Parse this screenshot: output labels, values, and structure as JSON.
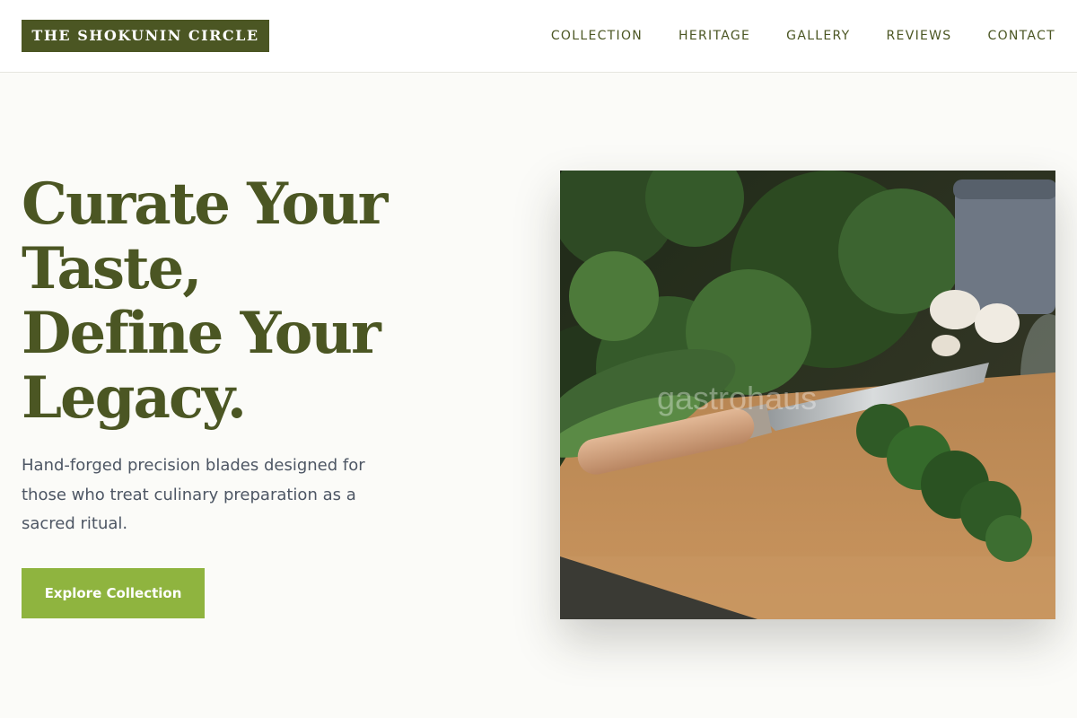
{
  "brand": {
    "logo_text": "THE SHOKUNIN CIRCLE"
  },
  "nav": {
    "links": [
      "COLLECTION",
      "HERITAGE",
      "GALLERY",
      "REVIEWS",
      "CONTACT"
    ]
  },
  "hero": {
    "title_lines": [
      "Curate Your",
      "Taste,",
      "Define Your",
      "Legacy."
    ],
    "subtitle": "Hand-forged precision blades designed for those who treat culinary preparation as a sacred ritual.",
    "cta_label": "Explore Collection",
    "image_watermark": "gastrohaus"
  },
  "colors": {
    "brand_olive": "#4b5623",
    "accent_green": "#8fb43f",
    "page_background": "#fbfbf8",
    "body_text": "#4d5664"
  }
}
